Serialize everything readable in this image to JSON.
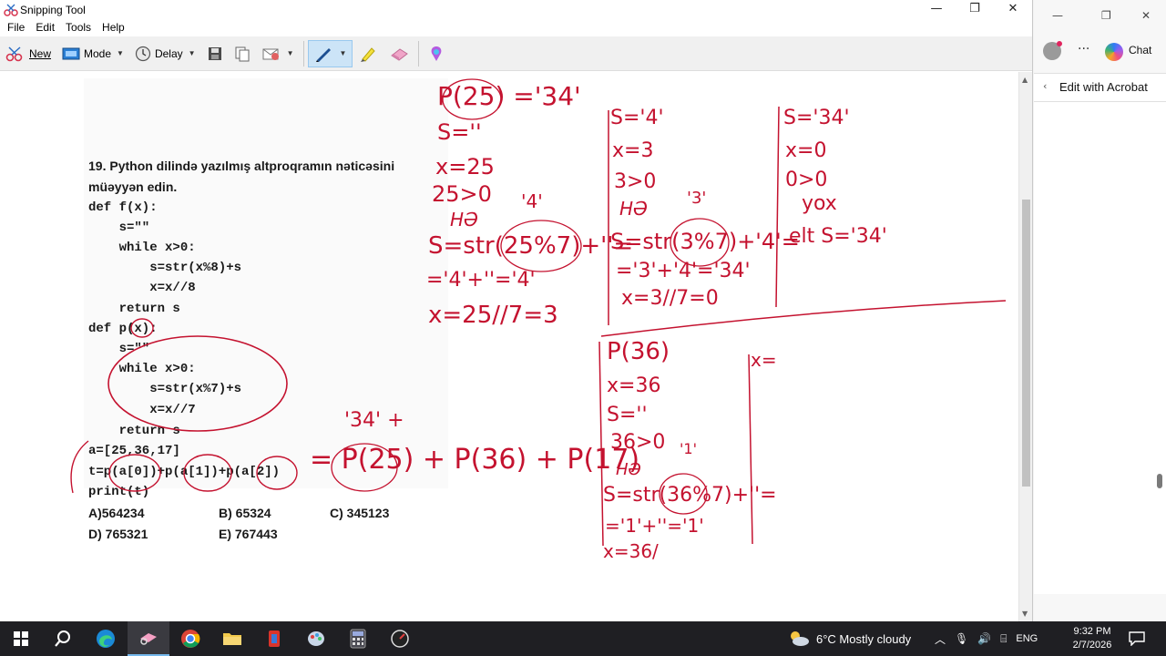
{
  "window": {
    "title": "Snipping Tool",
    "menu": [
      "File",
      "Edit",
      "Tools",
      "Help"
    ],
    "toolbar": {
      "new_label": "New",
      "mode_label": "Mode",
      "delay_label": "Delay"
    },
    "controls": {
      "minimize": "—",
      "restore": "❐",
      "close": "✕"
    }
  },
  "question": {
    "line1": "19. Python dilində yazılmış altproqramın nəticəsini",
    "line2": "müəyyən edin.",
    "code": [
      "def f(x):",
      "    s=\"\"",
      "    while x>0:",
      "        s=str(x%8)+s",
      "        x=x//8",
      "    return s",
      "def p(x):",
      "    s=\"\"",
      "    while x>0:",
      "        s=str(x%7)+s",
      "        x=x//7",
      "    return s",
      "a=[25,36,17]",
      "t=p(a[0])+p(a[1])+p(a[2])",
      "print(t)"
    ],
    "options": {
      "a": "A)564234",
      "b": "B) 65324",
      "c": "C) 345123",
      "d": "D) 765321",
      "e": "E) 767443"
    }
  },
  "handwriting": {
    "col1": [
      "P(25) ='34'",
      "S=''",
      "x=25",
      "25>0",
      "HƏ",
      "S=str(25%7)+''=",
      "='4'+''='4'",
      "x=25//7=3"
    ],
    "col1_note": "'4'",
    "col2": [
      "S='4'",
      "x=3",
      "3>0",
      "HƏ",
      "S=str(3%7)+'4'=",
      "='3'+'4'='34'",
      "x=3//7=0"
    ],
    "col2_note": "'3'",
    "col3": [
      "S='34'",
      "x=0",
      "0>0",
      "yox",
      "elt S='34'"
    ],
    "bottom": [
      "P(36)",
      "x=36",
      "S=''",
      "36>0",
      "HƏ",
      "S=str(36%7)+''=",
      "='1'+''='1'",
      "x=36/"
    ],
    "bottom_note": "'1'",
    "x_eq": "x=",
    "sum": "= P(25) + P(36) + P(17)",
    "sum_note": "'34' +"
  },
  "edge_panel": {
    "chat_label": "Chat",
    "acrobat_label": "Edit with Acrobat",
    "more": "···"
  },
  "taskbar": {
    "weather": "6°C  Mostly cloudy",
    "lang": "ENG",
    "time": "9:32 PM",
    "date": "2/7/2026"
  }
}
